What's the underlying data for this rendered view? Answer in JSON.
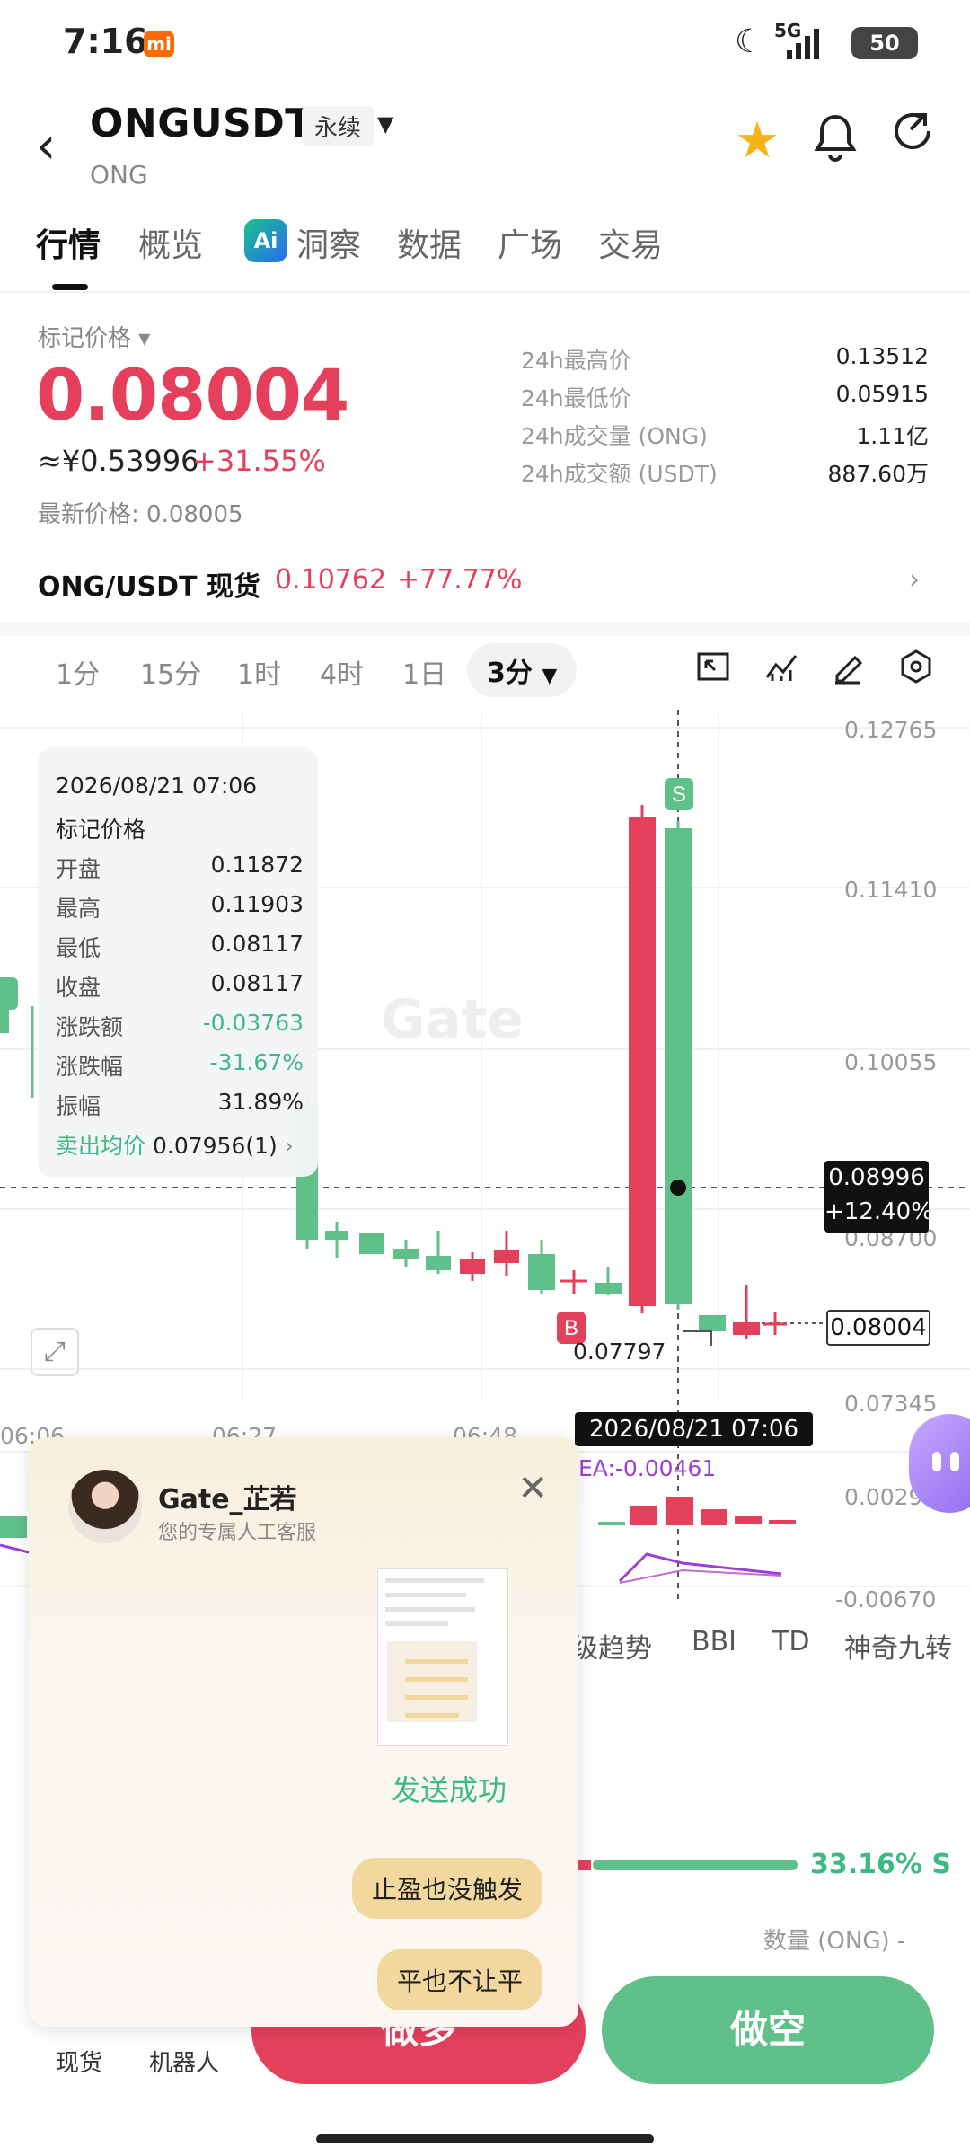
{
  "status_bar": {
    "time": "7:16",
    "battery": "50",
    "network": "5G"
  },
  "header": {
    "pair": "ONGUSDT",
    "contract_type": "永续",
    "base": "ONG"
  },
  "tabs": [
    "行情",
    "概览",
    "洞察",
    "数据",
    "广场",
    "交易"
  ],
  "ai_badge": "Ai",
  "price_panel": {
    "mark_label": "标记价格",
    "price": "0.08004",
    "cny": "≈¥0.53996",
    "change": "+31.55%",
    "last_price": "最新价格: 0.08005",
    "stats": [
      {
        "label": "24h最高价",
        "value": "0.13512"
      },
      {
        "label": "24h最低价",
        "value": "0.05915"
      },
      {
        "label": "24h成交量 (ONG)",
        "value": "1.11亿"
      },
      {
        "label": "24h成交额 (USDT)",
        "value": "887.60万"
      }
    ]
  },
  "spot": {
    "label": "ONG/USDT 现货",
    "price": "0.10762",
    "change": "+77.77%"
  },
  "intervals": [
    "1分",
    "15分",
    "1时",
    "4时",
    "1日",
    "3分"
  ],
  "chart": {
    "watermark": "Gate",
    "y_ticks": [
      "0.12765",
      "0.11410",
      "0.10055",
      "0.08700",
      "0.07345",
      "0.00296",
      "-0.00670"
    ],
    "x_ticks": [
      "06:06",
      "06:27",
      "06:48"
    ],
    "crosshair_price": "0.08996",
    "crosshair_change": "+12.40%",
    "current_price": "0.08004",
    "low_label": "0.07797",
    "time_tag": "2026/08/21 07:06",
    "ema_label": "EA:-0.00461",
    "tooltip": {
      "date": "2026/08/21 07:06",
      "title": "标记价格",
      "rows": [
        {
          "label": "开盘",
          "value": "0.11872"
        },
        {
          "label": "最高",
          "value": "0.11903"
        },
        {
          "label": "最低",
          "value": "0.08117"
        },
        {
          "label": "收盘",
          "value": "0.08117"
        },
        {
          "label": "涨跌额",
          "value": "-0.03763"
        },
        {
          "label": "涨跌幅",
          "value": "-31.67%"
        },
        {
          "label": "振幅",
          "value": "31.89%"
        }
      ],
      "avg_label": "卖出均价",
      "avg_value": "0.07956(1)"
    },
    "indicator_tabs": [
      "级趋势",
      "BBI",
      "TD",
      "神奇九转"
    ],
    "colors": {
      "up": "#5fc089",
      "down": "#e4405c",
      "accent": "#f5b31a"
    }
  },
  "chat_popup": {
    "agent_name": "Gate_芷若",
    "agent_sub": "您的专属人工客服",
    "sent_status": "发送成功",
    "messages": [
      "止盈也没触发",
      "平也不让平"
    ]
  },
  "ratio": {
    "value": "33.16% S",
    "qty_label": "数量 (ONG) -"
  },
  "bottom": {
    "spot_link": "现货",
    "bot_link": "机器人",
    "long": "做多",
    "short": "做空"
  }
}
